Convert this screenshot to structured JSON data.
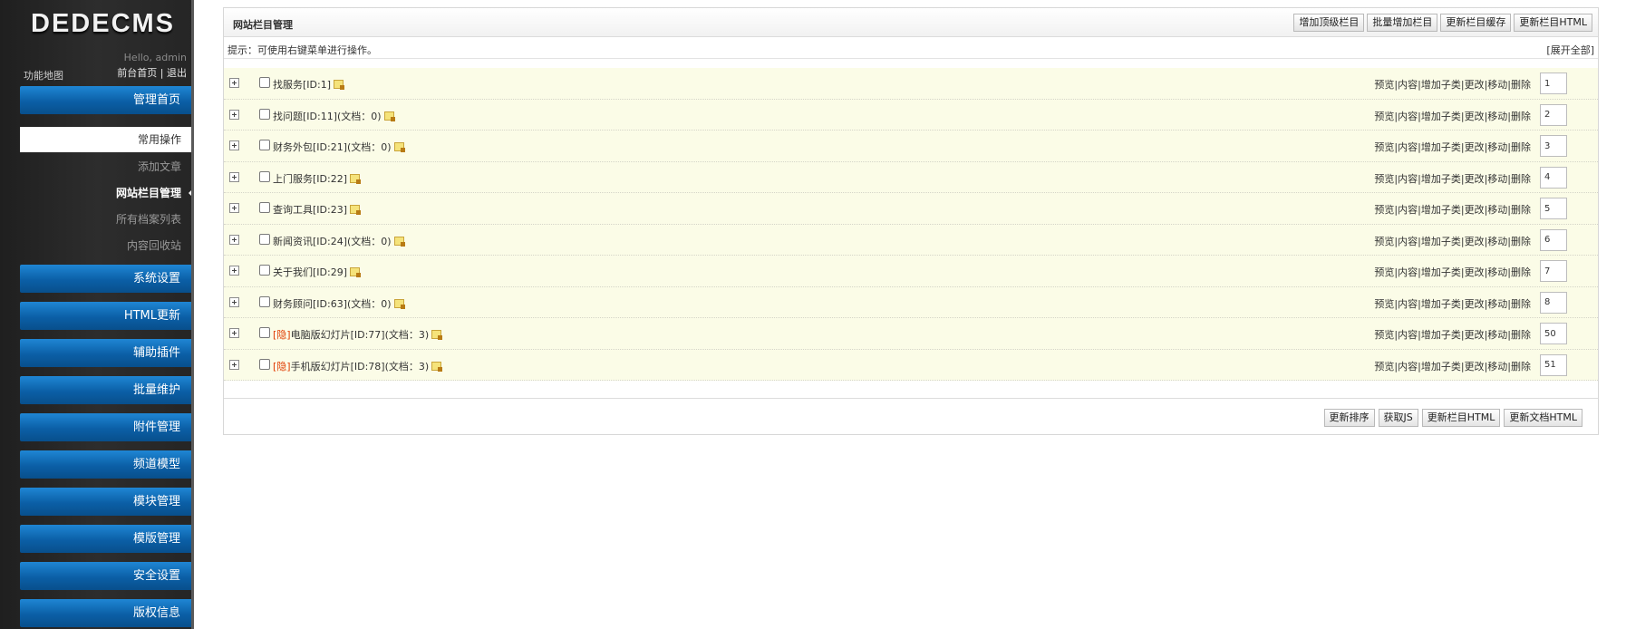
{
  "sidebar": {
    "logo": "DEDECMS",
    "hello": "Hello, admin",
    "front_link": "前台首页",
    "sep": "|",
    "logout": "退出",
    "func_map": "功能地图",
    "home_btn": "管理首页",
    "section": "常用操作",
    "sub_items": [
      "添加文章",
      "网站栏目管理",
      "所有档案列表",
      "内容回收站"
    ],
    "menu": [
      "系统设置",
      "HTML更新",
      "辅助插件",
      "批量维护",
      "附件管理",
      "频道模型",
      "模块管理",
      "模版管理",
      "安全设置",
      "版权信息"
    ]
  },
  "panel": {
    "title": "网站栏目管理",
    "header_buttons": [
      "增加顶级栏目",
      "批量增加栏目",
      "更新栏目缓存",
      "更新栏目HTML"
    ],
    "tip": "提示：可使用右键菜单进行操作。",
    "expand_all": "[展开全部]",
    "ops": [
      "预览",
      "内容",
      "增加子类",
      "更改",
      "移动",
      "删除"
    ],
    "op_sep": "|",
    "rows": [
      {
        "name": "找服务[ID:1]",
        "hidden_tag": "",
        "order": "1"
      },
      {
        "name": "找问题[ID:11](文档：0)",
        "hidden_tag": "",
        "order": "2"
      },
      {
        "name": "财务外包[ID:21](文档：0)",
        "hidden_tag": "",
        "order": "3"
      },
      {
        "name": "上门服务[ID:22]",
        "hidden_tag": "",
        "order": "4"
      },
      {
        "name": "查询工具[ID:23]",
        "hidden_tag": "",
        "order": "5"
      },
      {
        "name": "新闻资讯[ID:24](文档：0)",
        "hidden_tag": "",
        "order": "6"
      },
      {
        "name": "关于我们[ID:29]",
        "hidden_tag": "",
        "order": "7"
      },
      {
        "name": "财务顾问[ID:63](文档：0)",
        "hidden_tag": "",
        "order": "8"
      },
      {
        "name": "电脑版幻灯片[ID:77](文档：3)",
        "hidden_tag": "[隐]",
        "order": "50"
      },
      {
        "name": "手机版幻灯片[ID:78](文档：3)",
        "hidden_tag": "[隐]",
        "order": "51"
      }
    ],
    "footer_buttons": [
      "更新排序",
      "获取JS",
      "更新栏目HTML",
      "更新文档HTML"
    ]
  },
  "colors": {
    "nav_blue": "#0b5fa6",
    "row_bg": "#fbfce7",
    "hidden_red": "#e03a00"
  }
}
